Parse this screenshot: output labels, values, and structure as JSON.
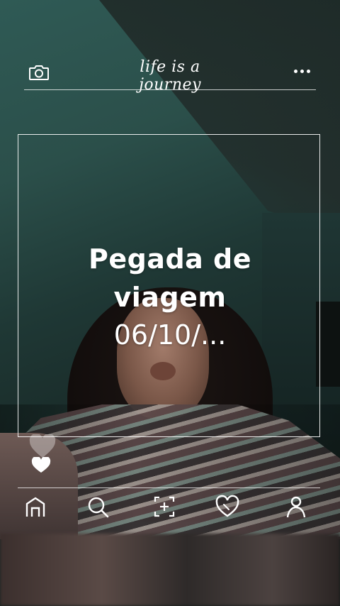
{
  "header": {
    "title": "life is a journey",
    "camera_icon": "camera-icon",
    "more_icon": "more-dots-icon"
  },
  "post": {
    "caption_line1": "Pegada de",
    "caption_line2": "viagem",
    "caption_line3": "06/10/..."
  },
  "nav": {
    "items": [
      {
        "icon": "home-icon"
      },
      {
        "icon": "search-icon"
      },
      {
        "icon": "add-post-icon"
      },
      {
        "icon": "heart-icon"
      },
      {
        "icon": "profile-icon"
      }
    ]
  },
  "colors": {
    "ui_stroke": "#ffffff",
    "wall": "#2b4f4a"
  }
}
